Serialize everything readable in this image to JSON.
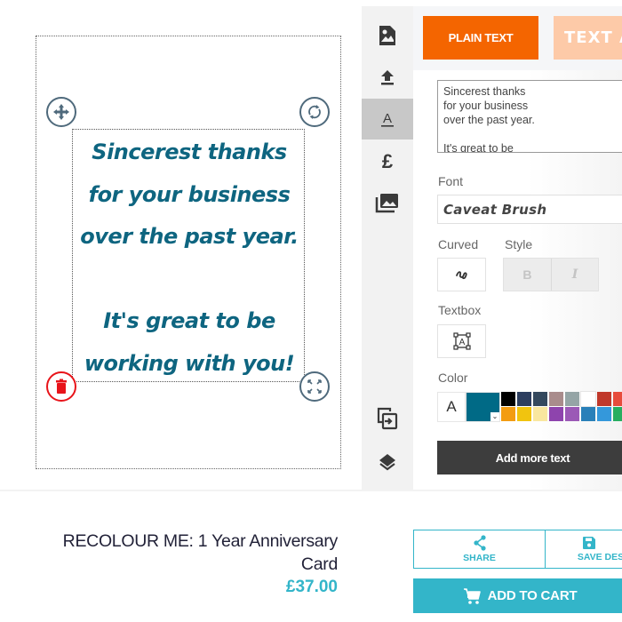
{
  "canvas": {
    "card_lines": [
      "Sincerest thanks",
      "for your business",
      "over the past year.",
      "",
      "It's great to be",
      "working with you!"
    ],
    "text_color": "#0e6580",
    "handles": {
      "move": "move-icon",
      "rotate": "rotate-icon",
      "delete": "trash-icon",
      "resize": "resize-icon"
    }
  },
  "sidebar": {
    "items": [
      {
        "name": "image-icon",
        "active": false
      },
      {
        "name": "upload-icon",
        "active": false
      },
      {
        "name": "text-icon",
        "active": true
      },
      {
        "name": "pound-icon",
        "active": false
      },
      {
        "name": "gallery-icon",
        "active": false
      },
      {
        "name": "duplicate-icon",
        "active": false
      },
      {
        "name": "layers-icon",
        "active": false
      }
    ]
  },
  "panel": {
    "tabs": [
      {
        "label": "PLAIN TEXT",
        "active": true
      },
      {
        "label": "TEXT A",
        "active": false
      }
    ],
    "text_value": "Sincerest thanks\nfor your business\nover the past year.\n\nIt's great to be",
    "font_label": "Font",
    "font_value": "Caveat Brush",
    "curved_label": "Curved",
    "style_label": "Style",
    "bold_label": "B",
    "italic_label": "I",
    "textbox_label": "Textbox",
    "color_label": "Color",
    "color_a": "A",
    "current_color": "#006a86",
    "swatches": [
      "#000000",
      "#2c3e5f",
      "#34495e",
      "#a98c8c",
      "#95a5a6",
      "#ffffff",
      "#c0392b",
      "#e74c3c",
      "#f39c12",
      "#f1c40f",
      "#f9e79f",
      "#8e44ad",
      "#9b59b6",
      "#2980b9",
      "#3498db",
      "#27ae60"
    ],
    "add_more_text": "Add more text"
  },
  "product": {
    "title_line1": "RECOLOUR ME: 1 Year Anniversary",
    "title_line2": "Card",
    "price": "£37.00",
    "share_label": "SHARE",
    "save_label": "SAVE DES",
    "add_to_cart": "ADD TO CART"
  }
}
